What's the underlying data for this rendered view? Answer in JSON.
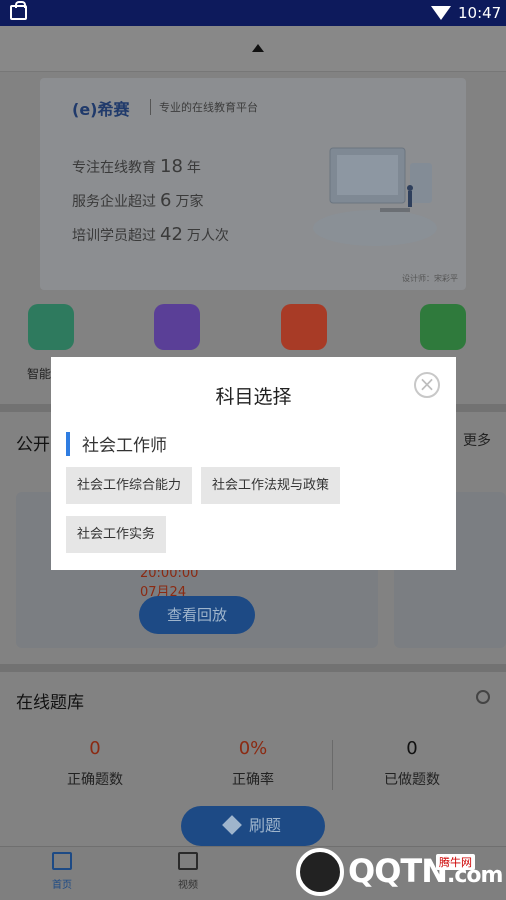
{
  "status_bar": {
    "time": "10:47"
  },
  "banner": {
    "logo": "(e)希赛",
    "slogan": "专业的在线教育平台",
    "stats": [
      {
        "prefix": "专注在线教育",
        "value": "18",
        "suffix": "年"
      },
      {
        "prefix": "服务企业超过",
        "value": "6",
        "suffix": "万家"
      },
      {
        "prefix": "培训学员超过",
        "value": "42",
        "suffix": "万人次"
      }
    ],
    "credit": "设计师：宋彩平"
  },
  "quick_entries": [
    {
      "label": "智能",
      "color": "#2e7a5e"
    },
    {
      "label": "",
      "color": "#5a3f97"
    },
    {
      "label": "",
      "color": "#a83b26"
    },
    {
      "label": "",
      "color": "#2f7a3c"
    }
  ],
  "open_class": {
    "title": "公开",
    "more": "更多",
    "time": "20:00:00 07月24日",
    "replay_button": "查看回放"
  },
  "question_bank": {
    "title": "在线题库",
    "stats": [
      {
        "value": "0",
        "label": "正确题数"
      },
      {
        "value": "0%",
        "label": "正确率"
      },
      {
        "value": "0",
        "label": "已做题数"
      }
    ],
    "refresh_button": "刷题"
  },
  "tabs": [
    {
      "label": "首页",
      "active": true
    },
    {
      "label": "视频",
      "active": false
    }
  ],
  "watermark": {
    "text": "QQTN",
    "suffix": ".com",
    "tag": "腾牛网"
  },
  "modal": {
    "title": "科目选择",
    "close_icon": "×",
    "category": "社会工作师",
    "subjects": [
      "社会工作综合能力",
      "社会工作法规与政策",
      "社会工作实务"
    ]
  }
}
